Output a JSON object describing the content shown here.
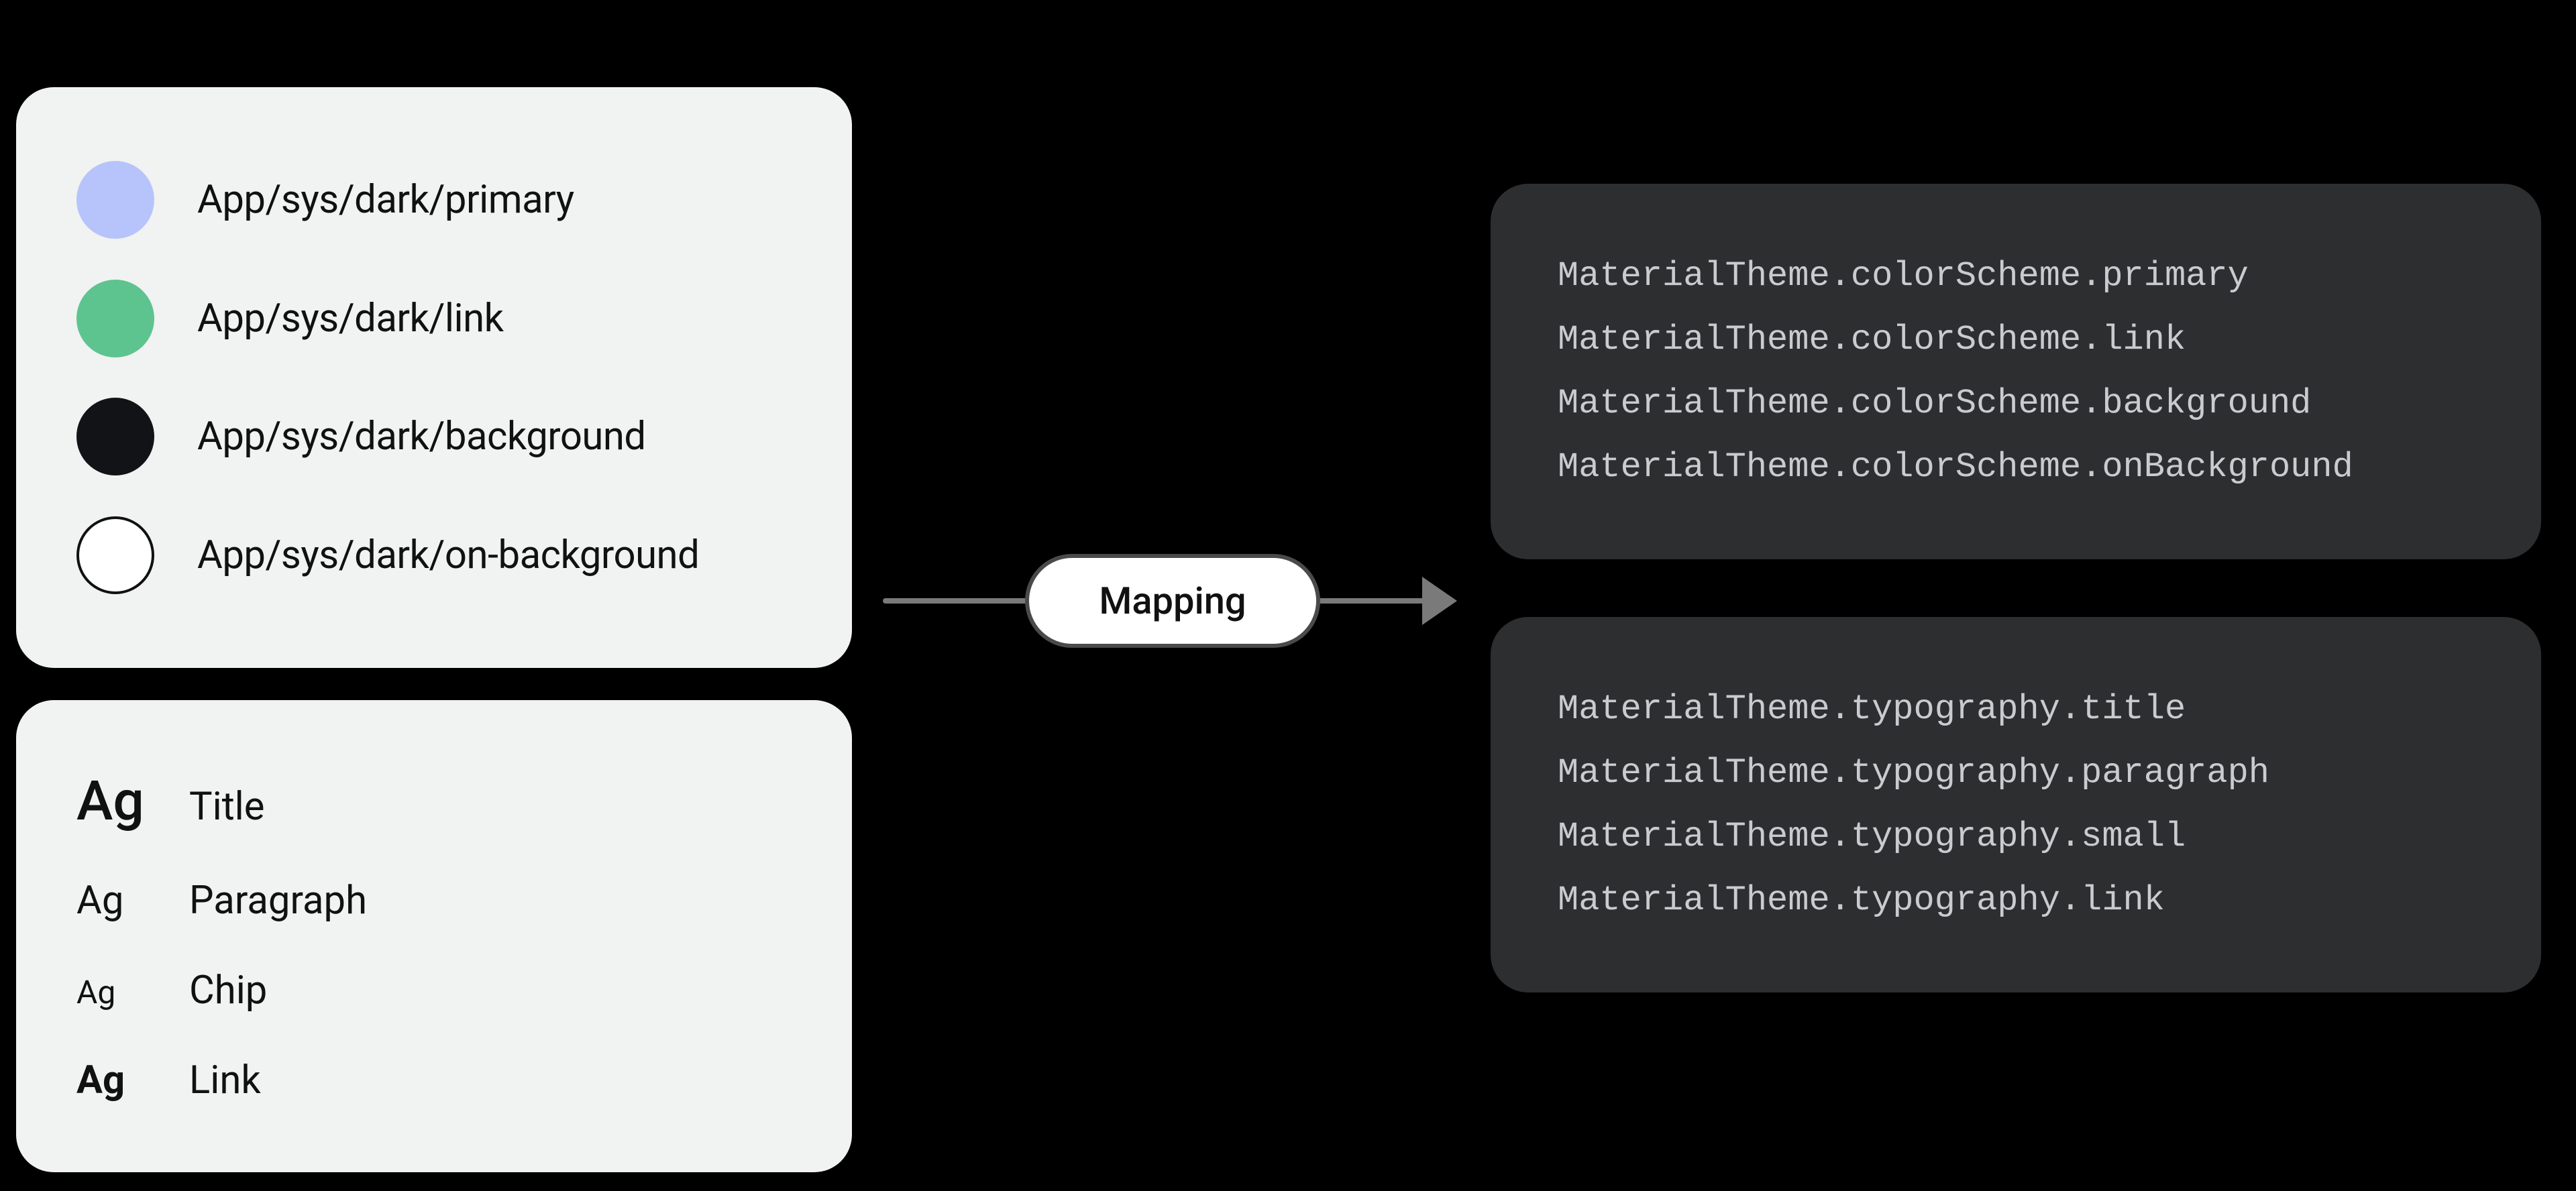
{
  "colors": {
    "primary": {
      "label": "App/sys/dark/primary",
      "hex": "#b6c4fb"
    },
    "link": {
      "label": "App/sys/dark/link",
      "hex": "#5ec48f"
    },
    "background": {
      "label": "App/sys/dark/background",
      "hex": "#121317"
    },
    "onBackground": {
      "label": "App/sys/dark/on-background",
      "hex": "#ffffff"
    }
  },
  "typography": {
    "sample": "Ag",
    "title": {
      "label": "Title"
    },
    "paragraph": {
      "label": "Paragraph"
    },
    "chip": {
      "label": "Chip"
    },
    "link": {
      "label": "Link"
    }
  },
  "mapping": {
    "label": "Mapping"
  },
  "code": {
    "colorScheme": {
      "l1": "MaterialTheme.colorScheme.primary",
      "l2": "MaterialTheme.colorScheme.link",
      "l3": "MaterialTheme.colorScheme.background",
      "l4": "MaterialTheme.colorScheme.onBackground"
    },
    "typographyScheme": {
      "l1": "MaterialTheme.typography.title",
      "l2": "MaterialTheme.typography.paragraph",
      "l3": "MaterialTheme.typography.small",
      "l4": "MaterialTheme.typography.link"
    }
  }
}
